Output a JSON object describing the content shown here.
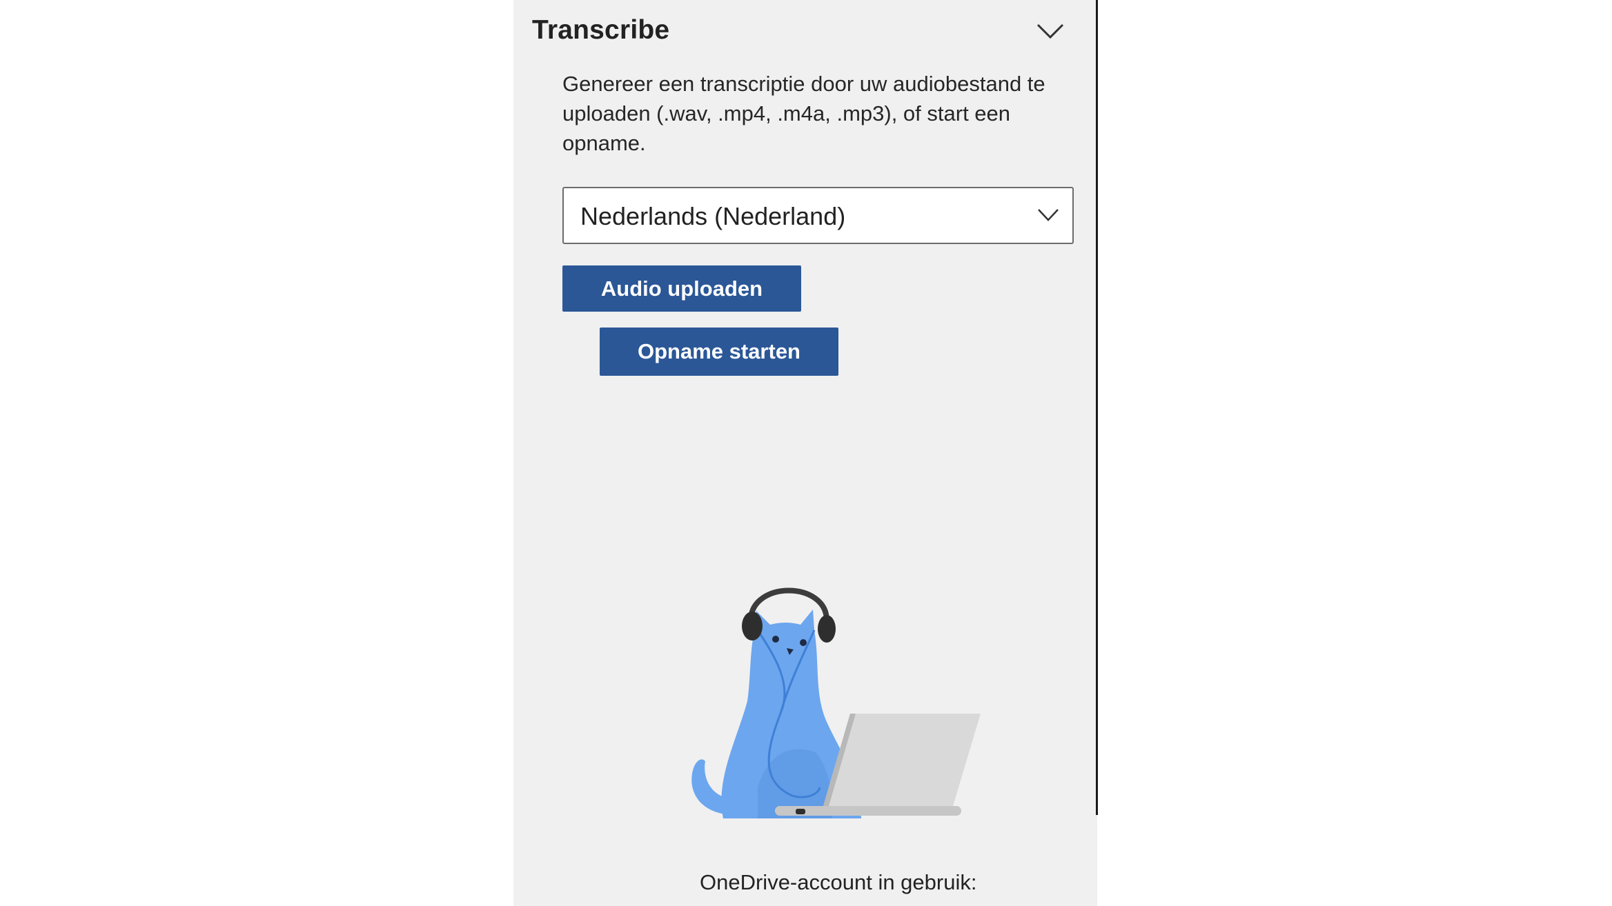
{
  "panel": {
    "title": "Transcribe",
    "description": "Genereer een transcriptie door uw audiobestand te uploaden (.wav, .mp4, .m4a, .mp3), of start een opname.",
    "language_select": {
      "selected": "Nederlands (Nederland)"
    },
    "buttons": {
      "upload_label": "Audio uploaden",
      "record_label": "Opname starten"
    },
    "footer": {
      "onedrive_label": "OneDrive-account in gebruik:"
    }
  },
  "icons": {
    "collapse": "chevron-down-icon",
    "dropdown": "chevron-down-icon",
    "illustration": "cat-headphones-laptop-illustration"
  },
  "colors": {
    "panel_background": "#f0f0f0",
    "button_primary": "#2b5797",
    "cat_body": "#6ca6ee"
  }
}
